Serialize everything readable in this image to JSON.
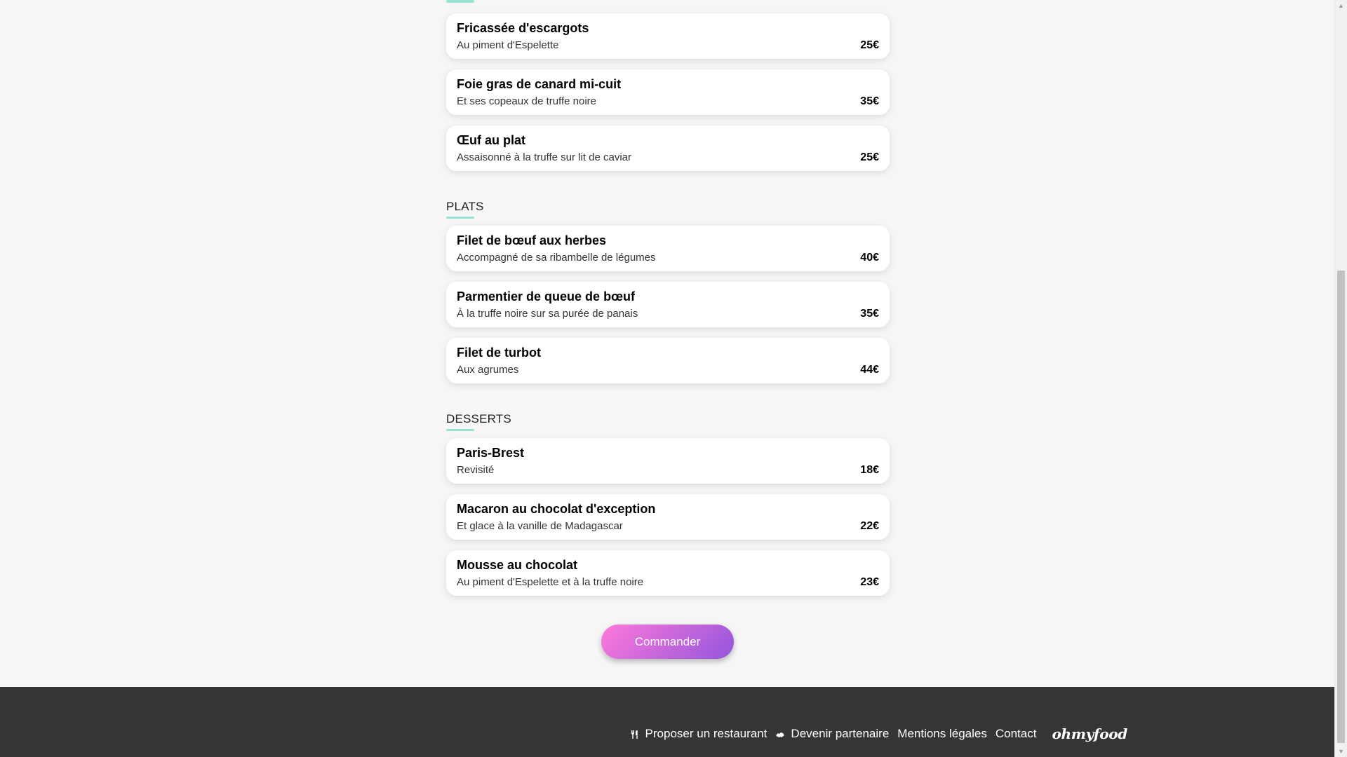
{
  "sections": [
    {
      "title": "",
      "dishes": [
        {
          "name": "Fricassée d'escargots",
          "desc": "Au piment d'Espelette",
          "price": "25€"
        },
        {
          "name": "Foie gras de canard mi-cuit",
          "desc": "Et ses copeaux de truffe noire",
          "price": "35€"
        },
        {
          "name": "Œuf au plat",
          "desc": "Assaisonné à la truffe sur lit de caviar",
          "price": "25€"
        }
      ]
    },
    {
      "title": "PLATS",
      "dishes": [
        {
          "name": "Filet de bœuf aux herbes",
          "desc": "Accompagné de sa ribambelle de légumes",
          "price": "40€"
        },
        {
          "name": "Parmentier de queue de bœuf",
          "desc": "À la truffe noire sur sa purée de panais",
          "price": "35€"
        },
        {
          "name": "Filet de turbot",
          "desc": "Aux agrumes",
          "price": "44€"
        }
      ]
    },
    {
      "title": "DESSERTS",
      "dishes": [
        {
          "name": "Paris-Brest",
          "desc": "Revisité",
          "price": "18€"
        },
        {
          "name": "Macaron au chocolat d'exception",
          "desc": "Et glace à la vanille de Madagascar",
          "price": "22€"
        },
        {
          "name": "Mousse au chocolat",
          "desc": "Au piment d'Espelette et à la truffe noire",
          "price": "23€"
        }
      ]
    }
  ],
  "order_button": {
    "label": "Commander"
  },
  "footer": {
    "links": [
      {
        "label": "Proposer un restaurant",
        "icon": "utensils-icon"
      },
      {
        "label": "Devenir partenaire",
        "icon": "handshake-icon"
      },
      {
        "label": "Mentions légales"
      },
      {
        "label": "Contact"
      }
    ],
    "brand": "ohmyfood"
  },
  "colors": {
    "accent_underline": "#99e2d0",
    "button_gradient_start": "#ff79da",
    "button_gradient_end": "#9356dc",
    "footer_bg": "#353535"
  }
}
